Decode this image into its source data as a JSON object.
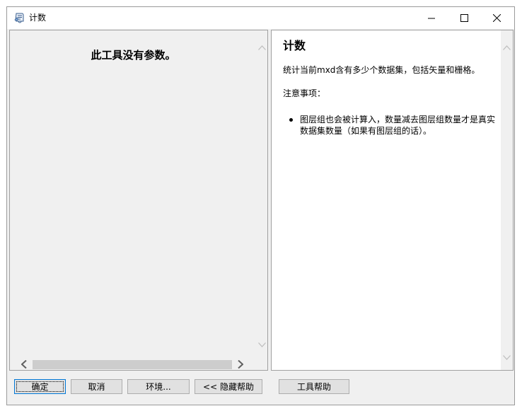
{
  "window": {
    "title": "计数",
    "controls": {
      "minimize": "minimize-icon",
      "maximize": "maximize-icon",
      "close": "close-icon"
    }
  },
  "params_pane": {
    "message": "此工具没有参数。"
  },
  "help": {
    "title": "计数",
    "description": "统计当前mxd含有多少个数据集，包括矢量和栅格。",
    "note_heading": "注意事项：",
    "bullets": [
      "图层组也会被计算入，数量减去图层组数量才是真实数据集数量（如果有图层组的话）。"
    ]
  },
  "buttons": {
    "ok": "确定",
    "cancel": "取消",
    "environments": "环境...",
    "hide_help": "<< 隐藏帮助",
    "tool_help": "工具帮助"
  },
  "colors": {
    "window_bg": "#f0f0f0",
    "pane_border": "#a0a0a0",
    "focus_border": "#0078d7"
  }
}
